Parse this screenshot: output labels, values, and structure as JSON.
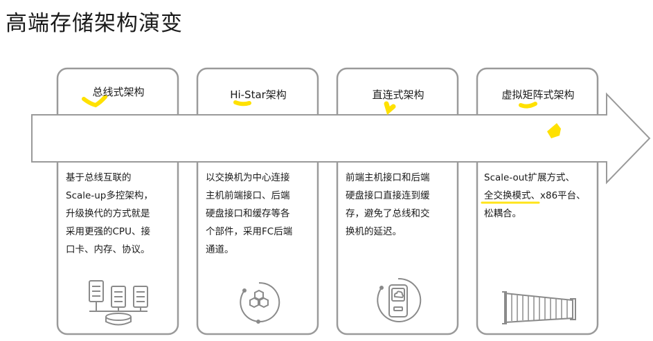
{
  "title": "高端存储架构演变",
  "stages": [
    {
      "title": "总线式架构",
      "lines": [
        "基于总线互联的",
        "Scale-up多控架构，",
        "升级换代的方式就是",
        "采用更强的CPU、接",
        "口卡、内存、协议。"
      ],
      "icon": "server-rack-icon"
    },
    {
      "title": "Hi-Star架构",
      "lines": [
        "以交换机为中心连接",
        "主机前端接口、后端",
        "硬盘接口和缓存等各",
        "个部件，采用FC后端",
        "通道。"
      ],
      "icon": "hexagon-cluster-icon"
    },
    {
      "title": "直连式架构",
      "lines": [
        "前端主机接口和后端",
        "硬盘接口直接连到缓",
        "存，避免了总线和交",
        "换机的延迟。"
      ],
      "icon": "storage-device-icon"
    },
    {
      "title": "虚拟矩阵式架构",
      "lines": [
        "Scale-out扩展方式、",
        "全交换模式、x86平台、",
        "松耦合。"
      ],
      "icon": "storage-array-icon"
    }
  ],
  "colors": {
    "border": "#9a9a9a",
    "icon": "#8a8a8a",
    "highlight": "#ffe100"
  }
}
